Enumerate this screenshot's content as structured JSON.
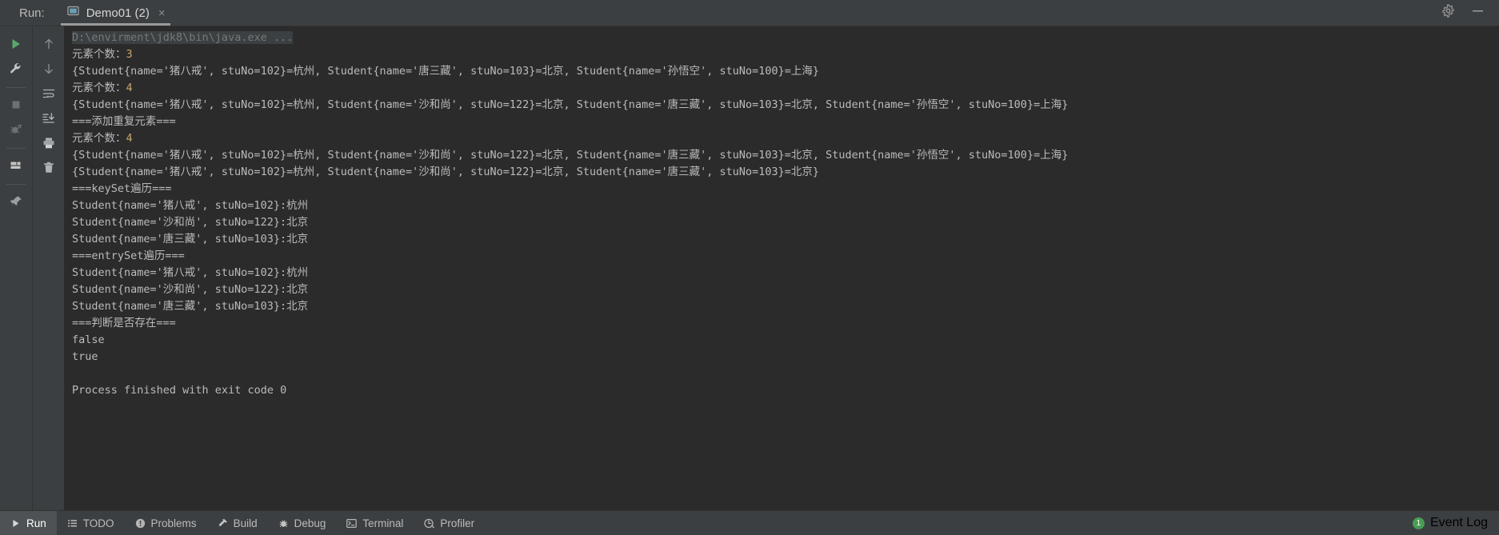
{
  "header": {
    "run_label": "Run:",
    "tab": {
      "title": "Demo01 (2)",
      "close": "×",
      "icon": "run-configuration-icon"
    },
    "settings_icon": "gear-icon",
    "minimize_icon": "minimize-icon"
  },
  "left_toolbar": {
    "items": [
      {
        "name": "rerun-button",
        "icon": "play-icon",
        "label": "Rerun"
      },
      {
        "name": "edit-configuration-button",
        "icon": "wrench-icon",
        "label": "Edit Configuration"
      },
      {
        "name": "stop-button",
        "icon": "stop-square-icon",
        "label": "Stop"
      },
      {
        "name": "debug-button",
        "icon": "bug-icon",
        "label": "Debug"
      },
      {
        "name": "layout-button",
        "icon": "layout-icon",
        "label": "Layout Settings"
      },
      {
        "name": "pin-button",
        "icon": "pin-icon",
        "label": "Pin Tab"
      }
    ]
  },
  "second_toolbar": {
    "items": [
      {
        "name": "up-button",
        "icon": "arrow-up-icon",
        "label": "Up the Stack Trace"
      },
      {
        "name": "down-button",
        "icon": "arrow-down-icon",
        "label": "Down the Stack Trace"
      },
      {
        "name": "soft-wrap-button",
        "icon": "soft-wrap-icon",
        "label": "Use Soft Wraps"
      },
      {
        "name": "scroll-to-end-button",
        "icon": "scroll-to-end-icon",
        "label": "Scroll to End"
      },
      {
        "name": "print-button",
        "icon": "printer-icon",
        "label": "Print"
      },
      {
        "name": "clear-all-button",
        "icon": "trash-icon",
        "label": "Clear All"
      }
    ]
  },
  "console": {
    "lines": [
      {
        "type": "cmd",
        "text": "D:\\envirment\\jdk8\\bin\\java.exe ..."
      },
      {
        "type": "out",
        "text": "元素个数：3"
      },
      {
        "type": "out",
        "text": "{Student{name='猪八戒', stuNo=102}=杭州, Student{name='唐三藏', stuNo=103}=北京, Student{name='孙悟空', stuNo=100}=上海}"
      },
      {
        "type": "out",
        "text": "元素个数：4"
      },
      {
        "type": "out",
        "text": "{Student{name='猪八戒', stuNo=102}=杭州, Student{name='沙和尚', stuNo=122}=北京, Student{name='唐三藏', stuNo=103}=北京, Student{name='孙悟空', stuNo=100}=上海}"
      },
      {
        "type": "out",
        "text": "===添加重复元素==="
      },
      {
        "type": "out",
        "text": "元素个数：4"
      },
      {
        "type": "out",
        "text": "{Student{name='猪八戒', stuNo=102}=杭州, Student{name='沙和尚', stuNo=122}=北京, Student{name='唐三藏', stuNo=103}=北京, Student{name='孙悟空', stuNo=100}=上海}"
      },
      {
        "type": "out",
        "text": "{Student{name='猪八戒', stuNo=102}=杭州, Student{name='沙和尚', stuNo=122}=北京, Student{name='唐三藏', stuNo=103}=北京}"
      },
      {
        "type": "out",
        "text": "===keySet遍历==="
      },
      {
        "type": "out",
        "text": "Student{name='猪八戒', stuNo=102}:杭州"
      },
      {
        "type": "out",
        "text": "Student{name='沙和尚', stuNo=122}:北京"
      },
      {
        "type": "out",
        "text": "Student{name='唐三藏', stuNo=103}:北京"
      },
      {
        "type": "out",
        "text": "===entrySet遍历==="
      },
      {
        "type": "out",
        "text": "Student{name='猪八戒', stuNo=102}:杭州"
      },
      {
        "type": "out",
        "text": "Student{name='沙和尚', stuNo=122}:北京"
      },
      {
        "type": "out",
        "text": "Student{name='唐三藏', stuNo=103}:北京"
      },
      {
        "type": "out",
        "text": "===判断是否存在==="
      },
      {
        "type": "out",
        "text": "false"
      },
      {
        "type": "out",
        "text": "true"
      },
      {
        "type": "blank",
        "text": ""
      },
      {
        "type": "out",
        "text": "Process finished with exit code 0"
      }
    ]
  },
  "statusbar": {
    "items": [
      {
        "name": "status-run",
        "icon": "play-icon",
        "label": "Run",
        "active": true
      },
      {
        "name": "status-todo",
        "icon": "list-icon",
        "label": "TODO",
        "active": false
      },
      {
        "name": "status-problems",
        "icon": "warning-icon",
        "label": "Problems",
        "active": false
      },
      {
        "name": "status-build",
        "icon": "hammer-icon",
        "label": "Build",
        "active": false
      },
      {
        "name": "status-debug",
        "icon": "bug-icon",
        "label": "Debug",
        "active": false
      },
      {
        "name": "status-terminal",
        "icon": "terminal-icon",
        "label": "Terminal",
        "active": false
      },
      {
        "name": "status-profiler",
        "icon": "profiler-icon",
        "label": "Profiler",
        "active": false
      }
    ],
    "event_log": {
      "label": "Event Log",
      "badge": "1",
      "badge_color": "#499c54"
    }
  }
}
